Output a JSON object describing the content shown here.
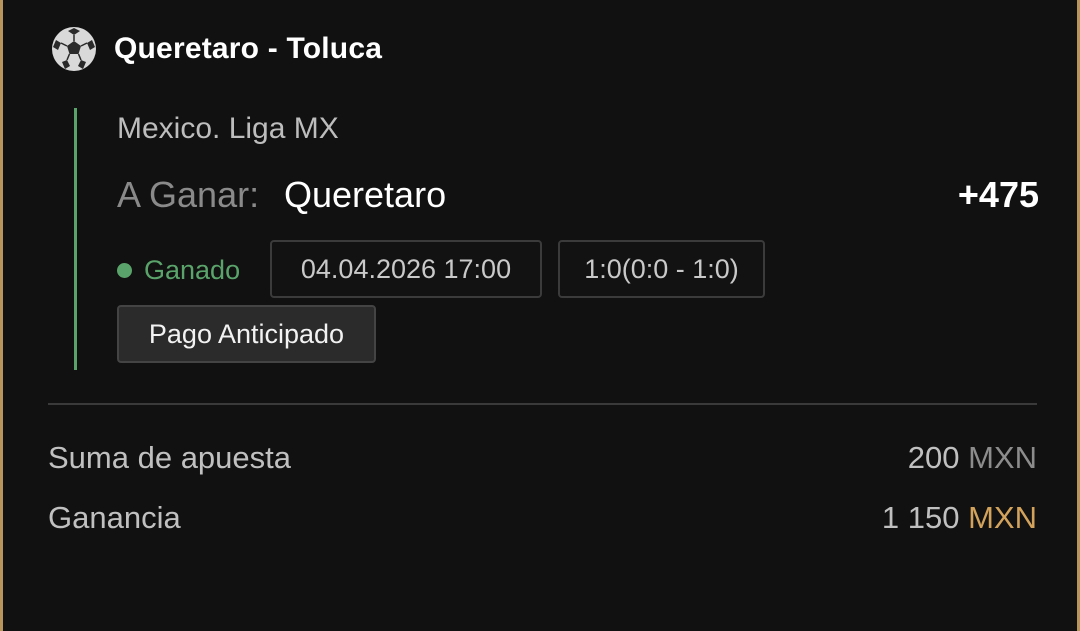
{
  "match": {
    "title": "Queretaro - Toluca",
    "icon": "soccer-ball-icon"
  },
  "bet": {
    "league": "Mexico. Liga MX",
    "market_label": "A Ganar:",
    "selection": "Queretaro",
    "odds": "+475",
    "status": "Ganado",
    "datetime": "04.04.2026 17:00",
    "score": "1:0(0:0 - 1:0)",
    "early_payout": "Pago Anticipado"
  },
  "summary": {
    "stake_label": "Suma de apuesta",
    "stake_amount": "200",
    "stake_currency": "MXN",
    "winnings_label": "Ganancia",
    "winnings_amount": "1 150",
    "winnings_currency": "MXN"
  },
  "colors": {
    "accent_gold": "#d3a35c",
    "border_gold": "#b8955a",
    "status_green": "#5aa36a",
    "background": "#111111"
  }
}
